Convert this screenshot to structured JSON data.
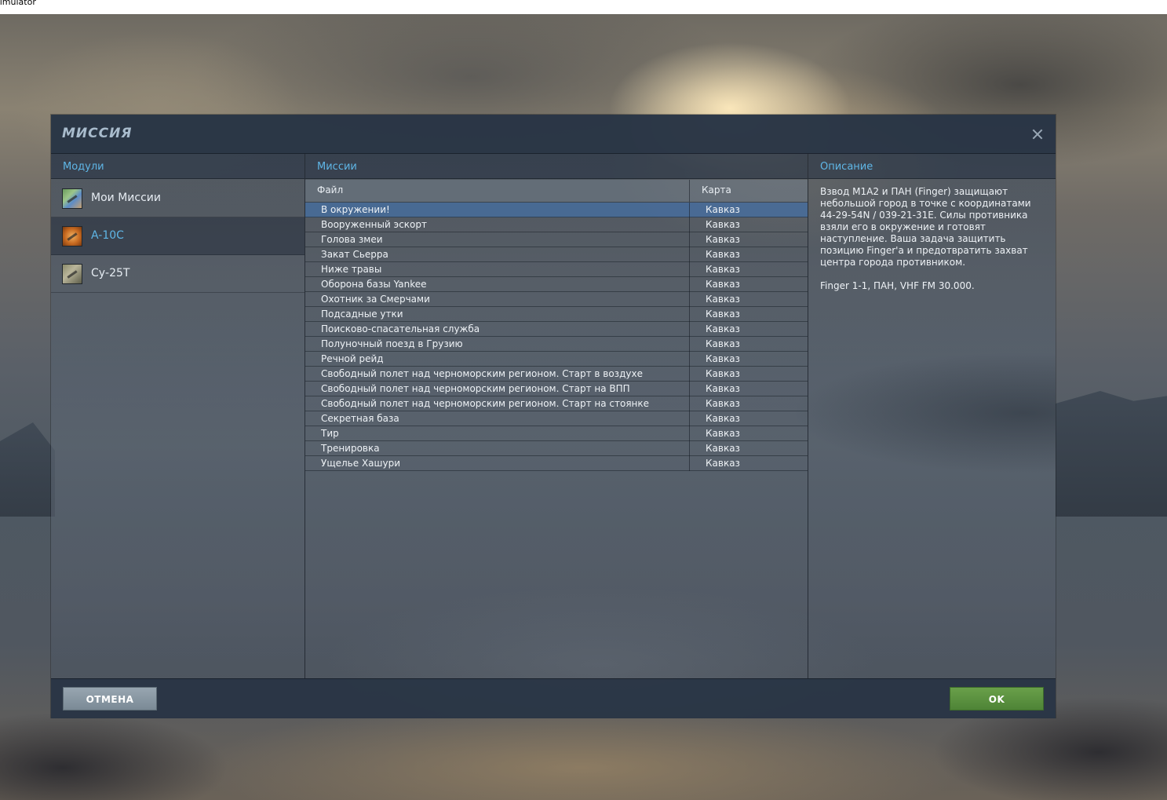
{
  "window": {
    "title": "simulator"
  },
  "dialog": {
    "title": "МИССИЯ",
    "close_icon": "close-icon"
  },
  "columns": {
    "modules": "Модули",
    "missions": "Миссии",
    "description": "Описание"
  },
  "modules": [
    {
      "label": "Мои Миссии",
      "icon": "map-icon",
      "selected": false
    },
    {
      "label": "A-10C",
      "icon": "a10-aircraft-icon",
      "selected": true
    },
    {
      "label": "Су-25Т",
      "icon": "su25-aircraft-icon",
      "selected": false
    }
  ],
  "missions_table": {
    "headers": {
      "file": "Файл",
      "map": "Карта"
    },
    "rows": [
      {
        "name": "В окружении!",
        "map": "Кавказ"
      },
      {
        "name": "Вооруженный эскорт",
        "map": "Кавказ"
      },
      {
        "name": "Голова змеи",
        "map": "Кавказ"
      },
      {
        "name": "Закат Сьерра",
        "map": "Кавказ"
      },
      {
        "name": "Ниже травы",
        "map": "Кавказ"
      },
      {
        "name": "Оборона базы Yankee",
        "map": "Кавказ"
      },
      {
        "name": "Охотник за Смерчами",
        "map": "Кавказ"
      },
      {
        "name": "Подсадные утки",
        "map": "Кавказ"
      },
      {
        "name": "Поисково-спасательная служба",
        "map": "Кавказ"
      },
      {
        "name": "Полуночный поезд в Грузию",
        "map": "Кавказ"
      },
      {
        "name": "Речной рейд",
        "map": "Кавказ"
      },
      {
        "name": "Свободный полет над черноморским регионом. Старт в воздухе",
        "map": "Кавказ"
      },
      {
        "name": "Свободный полет над черноморским регионом. Старт на ВПП",
        "map": "Кавказ"
      },
      {
        "name": "Свободный полет над черноморским регионом. Старт на стоянке",
        "map": "Кавказ"
      },
      {
        "name": "Секретная база",
        "map": "Кавказ"
      },
      {
        "name": "Тир",
        "map": "Кавказ"
      },
      {
        "name": "Тренировка",
        "map": "Кавказ"
      },
      {
        "name": "Ущелье Хашури",
        "map": "Кавказ"
      }
    ],
    "selected_index": 0
  },
  "description": {
    "paragraph1": "Взвод M1A2 и ПАН (Finger) защищают небольшой город в точке с координатами 44-29-54N / 039-21-31E. Силы противника взяли его в окружение и готовят наступление. Ваша задача защитить позицию Finger'a и предотвратить захват центра города противником.",
    "paragraph2": "Finger 1-1, ПАН, VHF FM 30.000."
  },
  "footer": {
    "cancel_label": "ОТМЕНА",
    "ok_label": "OK"
  },
  "colors": {
    "accent": "#5fb6e6",
    "ok_button": "#5a923f",
    "cancel_button": "#8a98a2",
    "selected_row": "#466ea0"
  }
}
